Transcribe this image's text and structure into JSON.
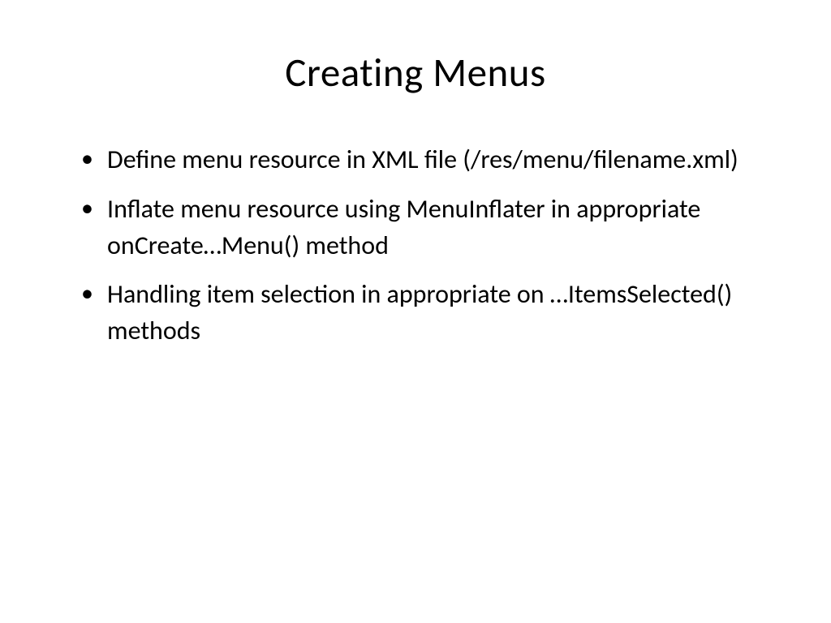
{
  "slide": {
    "title": "Creating Menus",
    "bullets": [
      "Define menu resource in XML file (/res/menu/filename.xml)",
      "Inflate menu resource using MenuInflater in appropriate onCreate…Menu() method",
      "Handling item selection in appropriate on …ItemsSelected() methods"
    ]
  }
}
